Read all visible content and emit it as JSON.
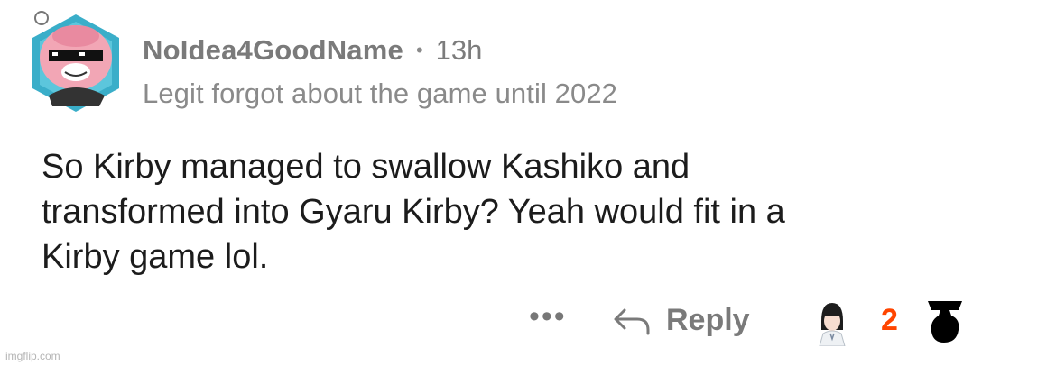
{
  "comment": {
    "username": "NoIdea4GoodName",
    "separator": "•",
    "time": "13h",
    "flair": "Legit forgot about the game until 2022",
    "body": "So Kirby managed to swallow Kashiko and\ntransformed into Gyaru Kirby? Yeah would fit in a\nKirby game lol."
  },
  "actions": {
    "more": "•••",
    "reply_label": "Reply",
    "vote_count": "2"
  },
  "watermark": "imgflip.com",
  "colors": {
    "vote_accent": "#ff4500",
    "avatar_bg": "#3aaec9",
    "avatar_pig": "#f2a6b5"
  }
}
